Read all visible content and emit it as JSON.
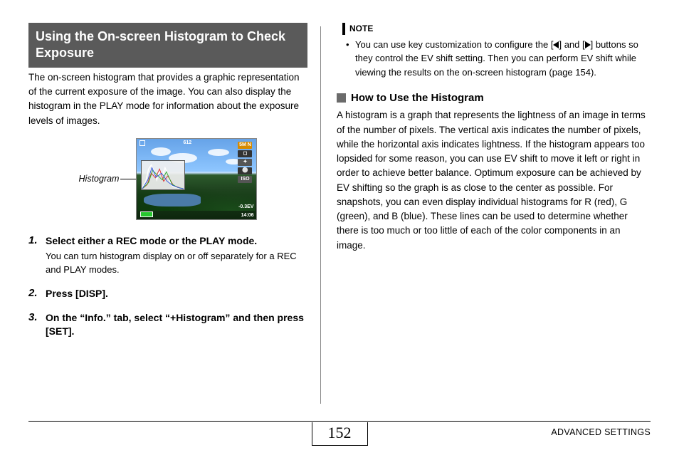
{
  "left": {
    "header": "Using the On-screen Histogram to Check Exposure",
    "intro": "The on-screen histogram that provides a graphic representation of the current exposure of the image. You can also display the histogram in the PLAY mode for information about the exposure levels of images.",
    "figure_label": "Histogram",
    "screen_overlay": {
      "top_num": "612",
      "badge": "5M N",
      "iso": "ISO",
      "ev": "-0.3EV",
      "time": "14:06"
    },
    "steps": [
      {
        "head": "Select either a REC mode or the PLAY mode.",
        "body": "You can turn histogram display on or off separately for a REC and PLAY modes."
      },
      {
        "head": "Press [DISP].",
        "body": ""
      },
      {
        "head": "On the “Info.” tab, select “+Histogram” and then press [SET].",
        "body": ""
      }
    ]
  },
  "right": {
    "note_label": "NOTE",
    "note_item_pre": "You can use key customization to configure the [",
    "note_item_mid": "] and [",
    "note_item_post": "] buttons so they control the EV shift setting. Then you can perform EV shift while viewing the results on the on-screen histogram (page 154).",
    "sub_heading": "How to Use the Histogram",
    "body": "A histogram is a graph that represents the lightness of an image in terms of the number of pixels. The vertical axis indicates the number of pixels, while the horizontal axis indicates lightness. If the histogram appears too lopsided for some reason, you can use EV shift to move it left or right in order to achieve better balance. Optimum exposure can be achieved by EV shifting so the graph is as close to the center as possible. For snapshots, you can even display individual histograms for R (red), G (green), and B (blue). These lines can be used to determine whether there is too much or too little of each of the color components in an image."
  },
  "footer": {
    "page": "152",
    "section": "ADVANCED SETTINGS"
  }
}
